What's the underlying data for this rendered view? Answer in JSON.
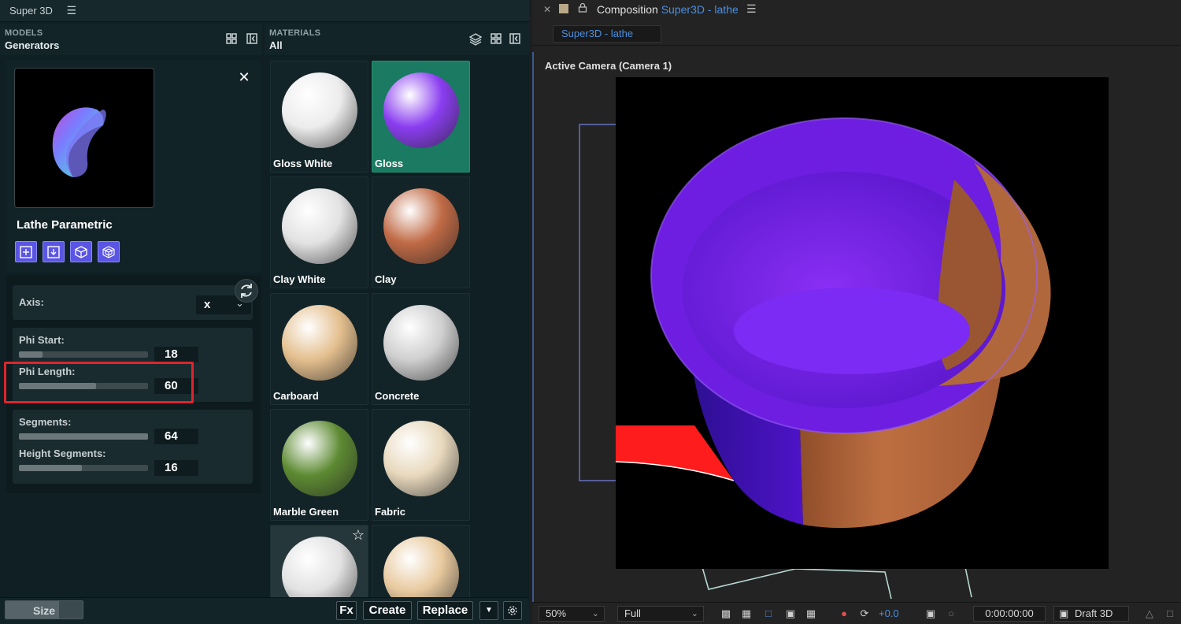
{
  "plugin": {
    "title": "Super 3D",
    "models_panel": {
      "section_label": "MODELS",
      "section_value": "Generators"
    },
    "materials_panel": {
      "section_label": "MATERIALS",
      "section_value": "All"
    },
    "model": {
      "name": "Lathe Parametric",
      "tools": [
        "add",
        "download",
        "box",
        "mesh"
      ]
    },
    "params": {
      "axis": {
        "label": "Axis:",
        "value": "x"
      },
      "phi_start": {
        "label": "Phi Start:",
        "value": "18",
        "fraction": 0.18
      },
      "phi_length": {
        "label": "Phi Length:",
        "value": "60",
        "fraction": 0.6
      },
      "segments": {
        "label": "Segments:",
        "value": "64",
        "fraction": 1.0
      },
      "height_segments": {
        "label": "Height Segments:",
        "value": "16",
        "fraction": 0.49
      }
    },
    "materials": [
      {
        "name": "Gloss White",
        "color": "#ececec",
        "selected": false
      },
      {
        "name": "Gloss",
        "color": "#8a3df0",
        "selected": true
      },
      {
        "name": "Clay White",
        "color": "#e2e2e2",
        "selected": false
      },
      {
        "name": "Clay",
        "color": "#c06a45",
        "selected": false
      },
      {
        "name": "Carboard",
        "color": "#e4bf8e",
        "selected": false
      },
      {
        "name": "Concrete",
        "color": "#cfcfcf",
        "selected": false
      },
      {
        "name": "Marble Green",
        "color": "#5d8a32",
        "selected": false
      },
      {
        "name": "Fabric",
        "color": "#e8d9bd",
        "selected": false
      },
      {
        "name": "",
        "color": "#e2e2e2",
        "selected": false
      },
      {
        "name": "",
        "color": "#e8c99e",
        "selected": false
      }
    ],
    "bottom": {
      "size_label": "Size",
      "fx_label": "Fx",
      "create_label": "Create",
      "replace_label": "Replace"
    }
  },
  "ae": {
    "panel_prefix": "Composition",
    "comp_name": "Super3D - lathe",
    "tab_label": "Super3D - lathe",
    "camera_label": "Active Camera (Camera 1)",
    "zoom": "50%",
    "resolution": "Full",
    "exposure": "+0.0",
    "timecode": "0:00:00:00",
    "renderer": "Draft 3D"
  },
  "colors": {
    "accent_purple": "#5a55e4",
    "selected_green": "#1a7a62",
    "highlight_red": "#e0242c",
    "ae_blue": "#4c8fe0"
  }
}
